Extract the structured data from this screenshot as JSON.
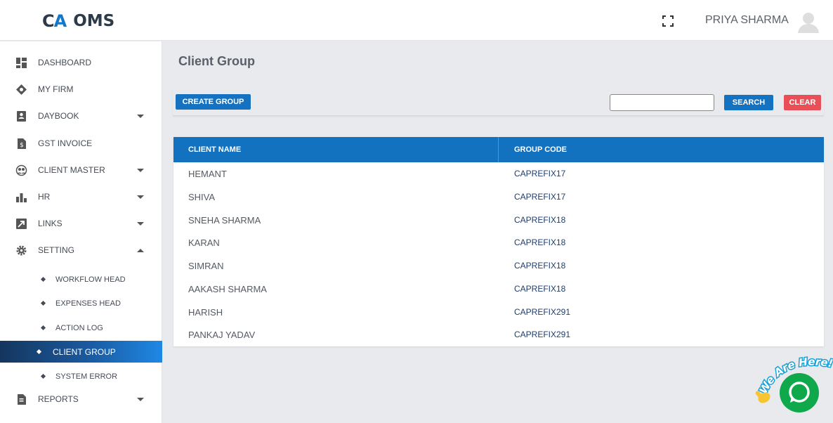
{
  "header": {
    "logo_mark": "CA",
    "logo_text": "OMS",
    "user_name": "PRIYA SHARMA"
  },
  "sidebar": {
    "items": [
      {
        "label": "DASHBOARD",
        "icon": "dashboard-icon"
      },
      {
        "label": "MY FIRM",
        "icon": "firm-icon"
      },
      {
        "label": "DAYBOOK",
        "icon": "daybook-icon",
        "expandable": true
      },
      {
        "label": "GST INVOICE",
        "icon": "invoice-icon"
      },
      {
        "label": "CLIENT MASTER",
        "icon": "client-master-icon",
        "expandable": true
      },
      {
        "label": "HR",
        "icon": "bar-chart-icon",
        "expandable": true
      },
      {
        "label": "LINKS",
        "icon": "link-icon",
        "expandable": true
      },
      {
        "label": "SETTING",
        "icon": "gear-icon",
        "expandable": true,
        "expanded": true
      },
      {
        "label": "REPORTS",
        "icon": "reports-icon",
        "expandable": true
      }
    ],
    "setting_subitems": [
      {
        "label": "WORKFLOW HEAD"
      },
      {
        "label": "EXPENSES HEAD"
      },
      {
        "label": "ACTION LOG"
      },
      {
        "label": "CLIENT GROUP",
        "active": true
      },
      {
        "label": "SYSTEM ERROR"
      }
    ]
  },
  "main": {
    "title": "Client Group",
    "toolbar": {
      "create_label": "CREATE GROUP",
      "search_value": "",
      "search_label": "SEARCH",
      "clear_label": "CLEAR"
    },
    "table": {
      "columns": [
        "CLIENT NAME",
        "GROUP CODE"
      ],
      "rows": [
        {
          "name": "HEMANT",
          "code": "CAPREFIX17"
        },
        {
          "name": "SHIVA",
          "code": "CAPREFIX17"
        },
        {
          "name": "SNEHA SHARMA",
          "code": "CAPREFIX18"
        },
        {
          "name": "KARAN",
          "code": "CAPREFIX18"
        },
        {
          "name": "SIMRAN",
          "code": "CAPREFIX18"
        },
        {
          "name": "AAKASH SHARMA",
          "code": "CAPREFIX18"
        },
        {
          "name": "HARISH",
          "code": "CAPREFIX291"
        },
        {
          "name": "PANKAJ YADAV",
          "code": "CAPREFIX291"
        }
      ]
    }
  },
  "chat_widget": {
    "badge_text": "We Are Here!"
  },
  "colors": {
    "primary": "#1572c1",
    "danger": "#e94f57",
    "chat": "#0fa84a"
  }
}
